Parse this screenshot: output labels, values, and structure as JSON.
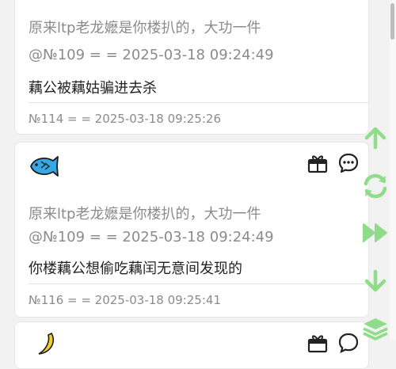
{
  "posts": [
    {
      "quote_line1": "原来ltp老龙嬷是你楼扒的，大功一件",
      "quote_line2": "@№109 = = 2025-03-18 09:24:49",
      "content": "藕公被藕姑骗进去杀",
      "meta": "№114 = = 2025-03-18 09:25:26"
    },
    {
      "avatar": "fish-avatar",
      "quote_line1": "原来ltp老龙嬷是你楼扒的，大功一件",
      "quote_line2": "@№109 = = 2025-03-18 09:24:49",
      "content": "你楼藕公想偷吃藕闰无意间发现的",
      "meta": "№116 = = 2025-03-18 09:25:41"
    },
    {
      "avatar": "banana-avatar"
    }
  ],
  "card_icons": [
    "gift-icon",
    "comment-icon"
  ],
  "floating_buttons": [
    "arrow-up-icon",
    "refresh-icon",
    "fast-forward-icon",
    "arrow-down-icon",
    "layers-icon"
  ],
  "colors": {
    "accent": "#8fdc8a",
    "text": "#222222",
    "muted": "#8b8b8b",
    "card": "#ffffff",
    "background": "#f2f2f2"
  }
}
